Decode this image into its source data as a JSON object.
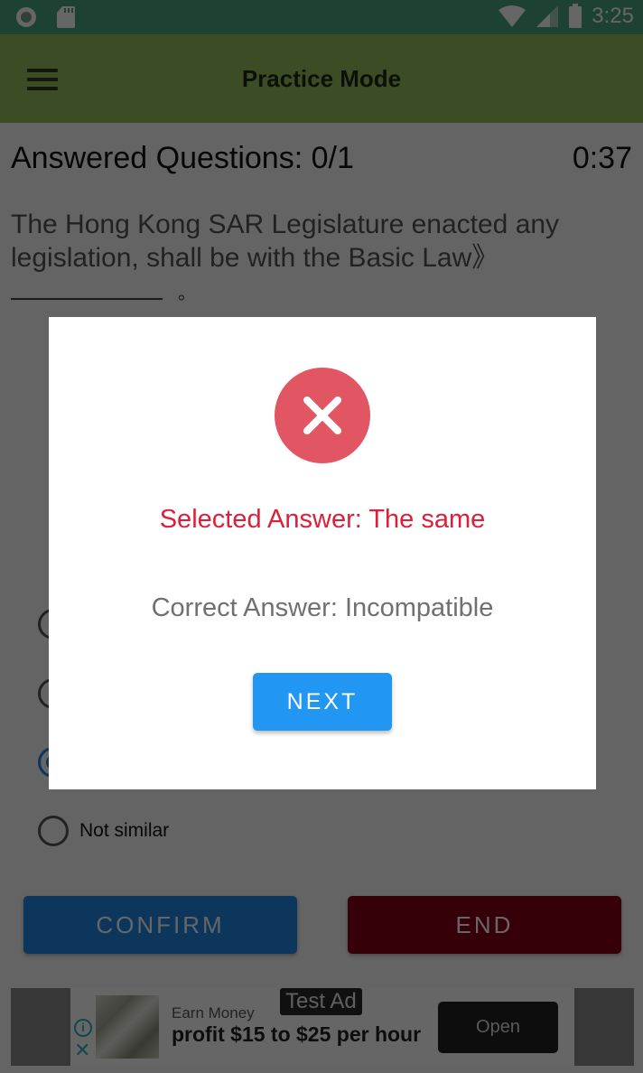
{
  "status_bar": {
    "time": "3:25",
    "left_icons": [
      "notification-circle-icon",
      "sd-card-icon"
    ],
    "right_icons": [
      "wifi-icon",
      "cell-signal-icon",
      "battery-icon"
    ]
  },
  "app_bar": {
    "title": "Practice Mode",
    "menu_icon": "hamburger-menu-icon"
  },
  "quiz": {
    "answered_label": "Answered Questions: 0/1",
    "timer": "0:37",
    "question_text": "The Hong Kong SAR Legislature enacted any legislation, shall be with the Basic Law》",
    "blank_suffix": "。",
    "options": [
      {
        "label": "",
        "selected": false
      },
      {
        "label": "",
        "selected": false
      },
      {
        "label": "The same",
        "selected": true
      },
      {
        "label": "Not similar",
        "selected": false
      }
    ],
    "confirm_label": "CONFIRM",
    "end_label": "END"
  },
  "ad": {
    "badge": "Test Ad",
    "subtitle": "Earn Money",
    "headline": "profit $15 to $25 per hour",
    "cta": "Open",
    "info_icon": "i",
    "close_icon": "✕"
  },
  "dialog": {
    "icon": "error-x-circle-icon",
    "selected_answer": "Selected Answer: The same",
    "correct_answer": "Correct Answer: Incompatible",
    "next_label": "NEXT",
    "colors": {
      "error": "#e25563",
      "selected_text": "#dd1f3a",
      "next_button": "#2196f3"
    }
  }
}
